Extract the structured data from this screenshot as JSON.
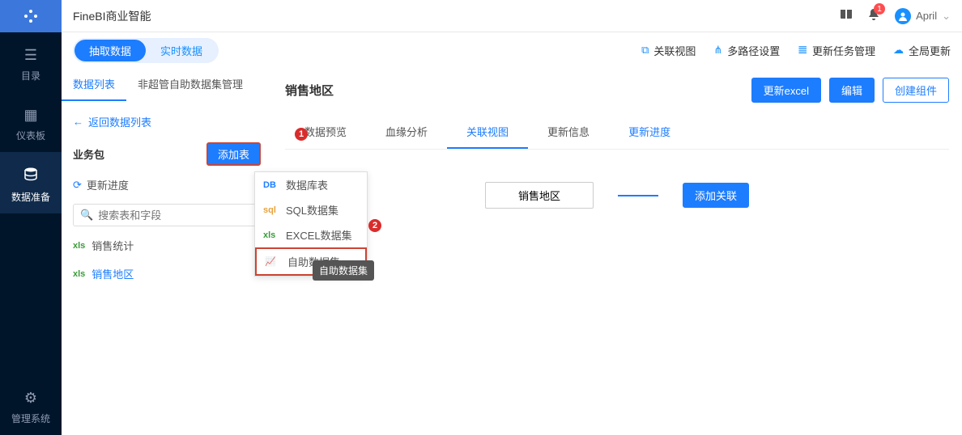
{
  "app_title": "FineBI商业智能",
  "notification_count": "1",
  "username": "April",
  "nav": {
    "directory": "目录",
    "dashboard": "仪表板",
    "data_prep": "数据准备",
    "admin": "管理系统"
  },
  "toggle": {
    "extract": "抽取数据",
    "realtime": "实时数据"
  },
  "toolbar": {
    "relation": "关联视图",
    "multipath": "多路径设置",
    "task": "更新任务管理",
    "global": "全局更新"
  },
  "left_tabs": {
    "list": "数据列表",
    "manage": "非超管自助数据集管理"
  },
  "back_link": "返回数据列表",
  "section": "业务包",
  "add_table": "添加表",
  "update_progress": "更新进度",
  "search_placeholder": "搜索表和字段",
  "tables": {
    "sales_stats": "销售统计",
    "sales_region": "销售地区"
  },
  "dropdown": {
    "db": "数据库表",
    "sql": "SQL数据集",
    "excel": "EXCEL数据集",
    "self": "自助数据集"
  },
  "tooltip": "自助数据集",
  "page_title": "销售地区",
  "buttons": {
    "excel": "更新excel",
    "edit": "编辑",
    "create": "创建组件"
  },
  "detail_tabs": {
    "preview": "数据预览",
    "blood": "血缘分析",
    "relation": "关联视图",
    "update_info": "更新信息",
    "update_prog": "更新进度"
  },
  "canvas": {
    "node": "销售地区",
    "add_relation": "添加关联"
  },
  "callouts": {
    "c1": "1",
    "c2": "2"
  }
}
